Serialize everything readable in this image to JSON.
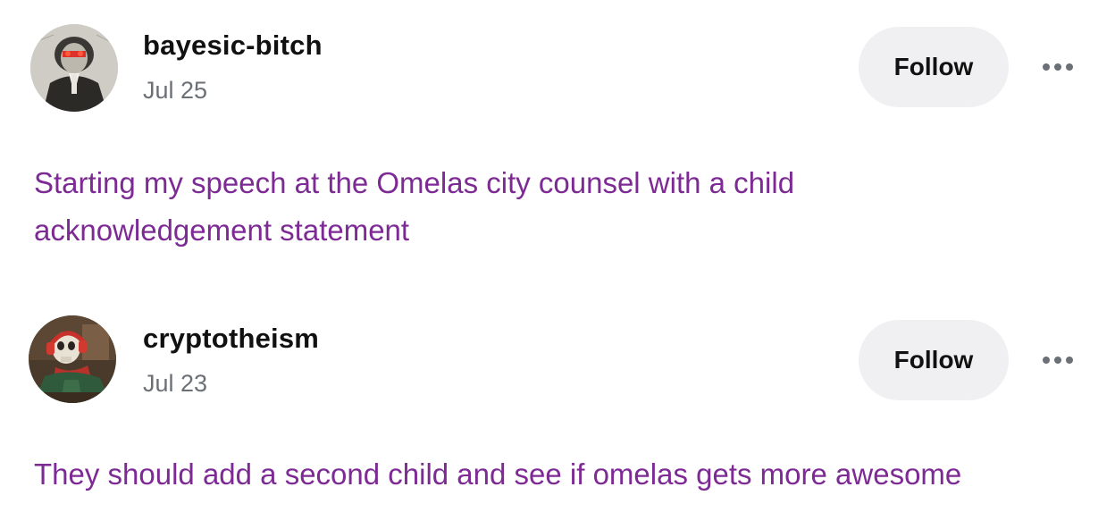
{
  "posts": [
    {
      "username": "bayesic-bitch",
      "date": "Jul 25",
      "follow_label": "Follow",
      "more_icon": "more-horizontal-icon",
      "avatar": "engraved-portrait-avatar",
      "text": "Starting my speech at the Omelas city counsel with a child acknowledgement statement"
    },
    {
      "username": "cryptotheism",
      "date": "Jul 23",
      "follow_label": "Follow",
      "more_icon": "more-horizontal-icon",
      "avatar": "skeleton-with-headphones-avatar",
      "text": "They should add a second child and see if omelas gets more awesome"
    }
  ],
  "colors": {
    "body_text": "#7d2a95",
    "username": "#111111",
    "date": "#6b6f76",
    "follow_bg": "#f0f0f2"
  }
}
